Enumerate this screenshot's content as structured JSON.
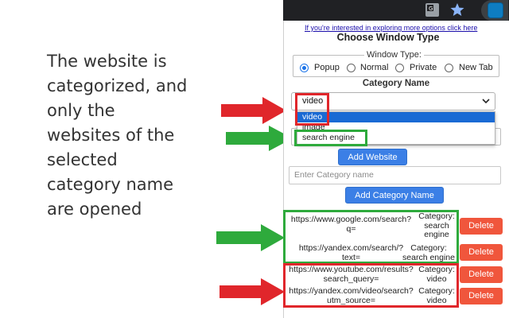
{
  "caption": {
    "lines": [
      "The website is",
      "categorized, and",
      "only the",
      "websites of the",
      "selected",
      "category name",
      "are opened"
    ]
  },
  "browser": {
    "icons": [
      "translate-icon",
      "bookmark-star-icon",
      "extension-icon"
    ]
  },
  "popup": {
    "top_link": "If you're interested in exploring more options click here",
    "title": "Choose Window Type",
    "window_type": {
      "legend": "Window Type:",
      "options": [
        "Popup",
        "Normal",
        "Private",
        "New Tab"
      ],
      "selected": "Popup"
    },
    "category_title": "Category Name",
    "category_select": {
      "value": "video",
      "options": [
        "video",
        "image",
        "search engine"
      ],
      "highlighted": "video"
    },
    "add_website_label": "Add Website",
    "category_input_placeholder": "Enter Category name",
    "add_category_label": "Add Category Name",
    "delete_label": "Delete",
    "entries": [
      {
        "url_line1": "https://www.google.com/search?",
        "url_line2": "q=",
        "cat_line1": "Category:",
        "cat_line2": "search",
        "cat_line3": "engine",
        "group": "search engine"
      },
      {
        "url_line1": "https://yandex.com/search/?",
        "url_line2": "text=",
        "cat_line1": "Category:",
        "cat_line2": "search engine",
        "group": "search engine"
      },
      {
        "url_line1": "https://www.youtube.com/results?",
        "url_line2": "search_query=",
        "cat_line1": "Category:",
        "cat_line2": "video",
        "group": "video"
      },
      {
        "url_line1": "https://yandex.com/video/search?",
        "url_line2": "utm_source=",
        "cat_line1": "Category:",
        "cat_line2": "video",
        "group": "video"
      }
    ]
  },
  "colors": {
    "highlight_red": "#e0262b",
    "highlight_green": "#2eaa3c",
    "button_blue": "#3b7fe6",
    "delete_red": "#f0563c"
  }
}
